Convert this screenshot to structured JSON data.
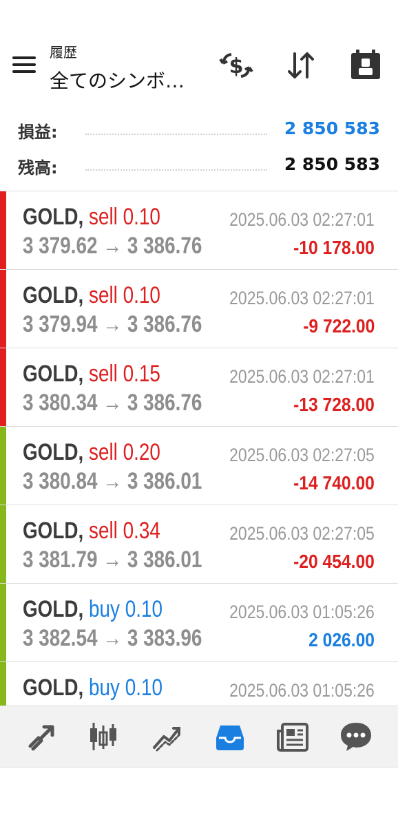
{
  "header": {
    "title": "履歴",
    "subtitle": "全てのシンボ…"
  },
  "actions": [
    {
      "name": "deposit-withdraw-icon"
    },
    {
      "name": "sort-icon"
    },
    {
      "name": "calendar-icon"
    }
  ],
  "summary": {
    "profit_label": "損益:",
    "profit_value": "2 850 583",
    "profit_color": "#1a7fe0",
    "balance_label": "残高:",
    "balance_value": "2 850 583"
  },
  "colors": {
    "loss": "#dd1f1f",
    "gain": "#1a7fe0",
    "bar_red": "#e21f1f",
    "bar_green": "#86b81b"
  },
  "trades": [
    {
      "symbol": "GOLD, ",
      "side": "sell 0.10",
      "time": "2025.06.03 02:27:01",
      "prices": "3 379.62 → 3 386.76",
      "profit": "-10 178.00",
      "bar": "red",
      "dir": "sell"
    },
    {
      "symbol": "GOLD, ",
      "side": "sell 0.10",
      "time": "2025.06.03 02:27:01",
      "prices": "3 379.94 → 3 386.76",
      "profit": "-9 722.00",
      "bar": "red",
      "dir": "sell"
    },
    {
      "symbol": "GOLD, ",
      "side": "sell 0.15",
      "time": "2025.06.03 02:27:01",
      "prices": "3 380.34 → 3 386.76",
      "profit": "-13 728.00",
      "bar": "red",
      "dir": "sell"
    },
    {
      "symbol": "GOLD, ",
      "side": "sell 0.20",
      "time": "2025.06.03 02:27:05",
      "prices": "3 380.84 → 3 386.01",
      "profit": "-14 740.00",
      "bar": "green",
      "dir": "sell"
    },
    {
      "symbol": "GOLD, ",
      "side": "sell 0.34",
      "time": "2025.06.03 02:27:05",
      "prices": "3 381.79 → 3 386.01",
      "profit": "-20 454.00",
      "bar": "green",
      "dir": "sell"
    },
    {
      "symbol": "GOLD, ",
      "side": "buy 0.10",
      "time": "2025.06.03 01:05:26",
      "prices": "3 382.54 → 3 383.96",
      "profit": "2 026.00",
      "bar": "green",
      "dir": "buy"
    },
    {
      "symbol": "GOLD, ",
      "side": "buy 0.10",
      "time": "2025.06.03 01:05:26",
      "prices": "",
      "profit": "",
      "bar": "green",
      "dir": "buy"
    }
  ],
  "nav": [
    {
      "name": "nav-trade-icon",
      "active": false
    },
    {
      "name": "nav-chart-icon",
      "active": false
    },
    {
      "name": "nav-quotes-icon",
      "active": false
    },
    {
      "name": "nav-history-icon",
      "active": true
    },
    {
      "name": "nav-news-icon",
      "active": false
    },
    {
      "name": "nav-chat-icon",
      "active": false
    }
  ]
}
